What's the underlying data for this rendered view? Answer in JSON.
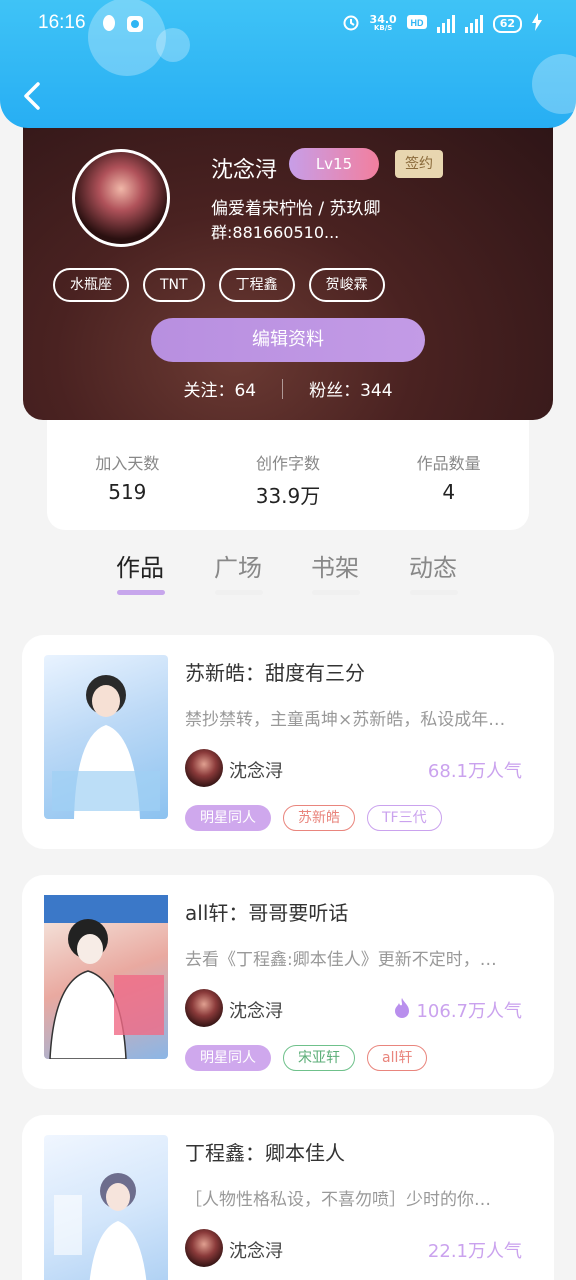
{
  "status_bar": {
    "time": "16:16",
    "speed": "34.0",
    "speed_unit": "KB/S",
    "battery": "62"
  },
  "profile": {
    "name": "沈念浔",
    "level": "Lv15",
    "badge": "签约",
    "bio": "偏爱着宋柠怡 / 苏玖卿",
    "group": "群:881660510...",
    "tags": [
      "水瓶座",
      "TNT",
      "丁程鑫",
      "贺峻霖"
    ],
    "edit_button": "编辑资料",
    "following_label": "关注：",
    "following": "64",
    "followers_label": "粉丝：",
    "followers": "344"
  },
  "stats": [
    {
      "label": "加入天数",
      "value": "519"
    },
    {
      "label": "创作字数",
      "value": "33.9万"
    },
    {
      "label": "作品数量",
      "value": "4"
    }
  ],
  "tabs": [
    "作品",
    "广场",
    "书架",
    "动态"
  ],
  "works": [
    {
      "title": "苏新皓：甜度有三分",
      "desc": "禁抄禁转，主童禹坤×苏新皓，私设成年…",
      "author": "沈念浔",
      "popularity": "68.1万人气",
      "tags": [
        "明星同人",
        "苏新皓",
        "TF三代"
      ]
    },
    {
      "title": "all轩：哥哥要听话",
      "desc": "去看《丁程鑫:卿本佳人》更新不定时，…",
      "author": "沈念浔",
      "popularity": "106.7万人气",
      "tags": [
        "明星同人",
        "宋亚轩",
        "all轩"
      ]
    },
    {
      "title": "丁程鑫：卿本佳人",
      "desc": "［人物性格私设，不喜勿喷］少时的你…",
      "author": "沈念浔",
      "popularity": "22.1万人气",
      "tags": []
    }
  ]
}
